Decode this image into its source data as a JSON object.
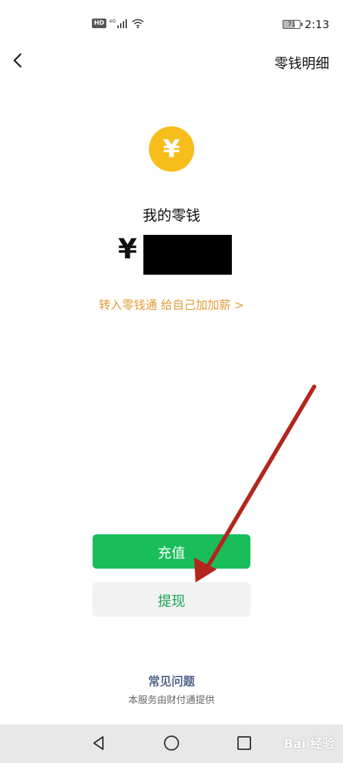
{
  "status_bar": {
    "network": "4G",
    "hd_label": "HD",
    "battery_level": "71",
    "time": "2:13"
  },
  "nav": {
    "title": "零钱明细"
  },
  "wallet": {
    "coin_symbol": "¥",
    "title": "我的零钱",
    "currency_symbol": "¥"
  },
  "promo": {
    "text": "转入零钱通 给自己加加薪 >"
  },
  "actions": {
    "recharge_label": "充值",
    "withdraw_label": "提现"
  },
  "footer": {
    "faq_label": "常见问题",
    "provider_text": "本服务由财付通提供"
  },
  "watermark": {
    "text": "Bai 经验"
  },
  "colors": {
    "accent_green": "#19be5b",
    "coin_yellow": "#f7bd1b",
    "promo_orange": "#e39d3a",
    "annotation_red": "#b3261e"
  }
}
